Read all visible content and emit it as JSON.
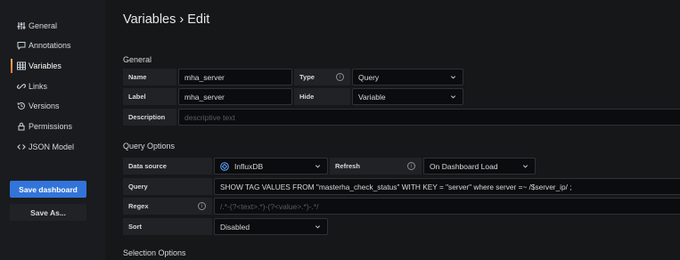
{
  "sidebar": {
    "items": [
      {
        "label": "General",
        "icon": "sliders-icon"
      },
      {
        "label": "Annotations",
        "icon": "comment-icon"
      },
      {
        "label": "Variables",
        "icon": "table-icon",
        "active": true
      },
      {
        "label": "Links",
        "icon": "link-icon"
      },
      {
        "label": "Versions",
        "icon": "history-icon"
      },
      {
        "label": "Permissions",
        "icon": "lock-icon"
      },
      {
        "label": "JSON Model",
        "icon": "code-icon"
      }
    ],
    "save_label": "Save dashboard",
    "save_as_label": "Save As..."
  },
  "header": {
    "title": "Variables › Edit"
  },
  "general": {
    "title": "General",
    "name_label": "Name",
    "name_value": "mha_server",
    "type_label": "Type",
    "type_value": "Query",
    "label_label": "Label",
    "label_value": "mha_server",
    "hide_label": "Hide",
    "hide_value": "Variable",
    "description_label": "Description",
    "description_placeholder": "descriptive text"
  },
  "query_options": {
    "title": "Query Options",
    "datasource_label": "Data source",
    "datasource_value": "InfluxDB",
    "refresh_label": "Refresh",
    "refresh_value": "On Dashboard Load",
    "query_label": "Query",
    "query_value": "SHOW TAG VALUES FROM \"masterha_check_status\" WITH KEY = \"server\" where server =~ /$server_ip/ ;",
    "regex_label": "Regex",
    "regex_placeholder": "/.*-(?<text>.*)-(?<value>.*)-.*/",
    "sort_label": "Sort",
    "sort_value": "Disabled"
  },
  "selection_options": {
    "title": "Selection Options"
  },
  "colors": {
    "primary": "#3274d9",
    "background": "#161719",
    "field": "#0b0c0e",
    "label": "#202226"
  }
}
